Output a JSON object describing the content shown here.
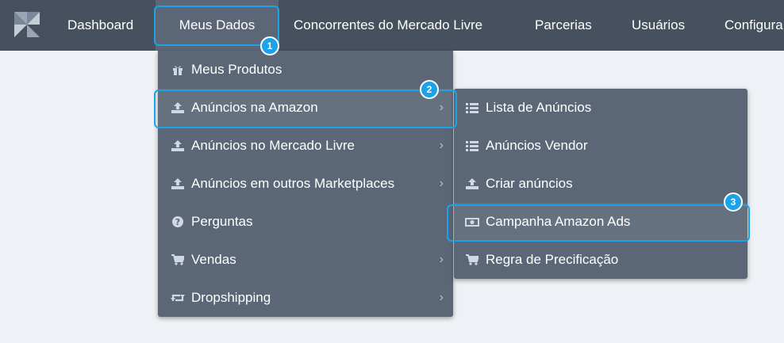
{
  "nav": {
    "items": [
      {
        "label": "Dashboard"
      },
      {
        "label": "Meus Dados"
      },
      {
        "label": "Concorrentes do Mercado Livre"
      },
      {
        "label": "Parcerias"
      },
      {
        "label": "Usuários"
      },
      {
        "label": "Configura"
      }
    ]
  },
  "menu_meus_dados": {
    "items": [
      {
        "label": "Meus Produtos",
        "icon": "gift-icon"
      },
      {
        "label": "Anúncios na Amazon",
        "icon": "upload-icon",
        "submenu": true
      },
      {
        "label": "Anúncios no Mercado Livre",
        "icon": "upload-icon",
        "submenu": true
      },
      {
        "label": "Anúncios em outros Marketplaces",
        "icon": "upload-icon",
        "submenu": true
      },
      {
        "label": "Perguntas",
        "icon": "question-circle-icon"
      },
      {
        "label": "Vendas",
        "icon": "cart-icon",
        "submenu": true
      },
      {
        "label": "Dropshipping",
        "icon": "retweet-icon",
        "submenu": true
      }
    ]
  },
  "menu_amazon": {
    "items": [
      {
        "label": "Lista de Anúncios",
        "icon": "list-icon"
      },
      {
        "label": "Anúncios Vendor",
        "icon": "list-icon"
      },
      {
        "label": "Criar anúncios",
        "icon": "upload-icon"
      },
      {
        "label": "Campanha Amazon Ads",
        "icon": "money-icon"
      },
      {
        "label": "Regra de Precificação",
        "icon": "cart-icon"
      }
    ]
  },
  "callouts": {
    "step1": "1",
    "step2": "2",
    "step3": "3"
  },
  "colors": {
    "topbar": "#46505f",
    "menu": "#5b6676",
    "highlight": "#1aa3e8",
    "background": "#eef1f5"
  }
}
